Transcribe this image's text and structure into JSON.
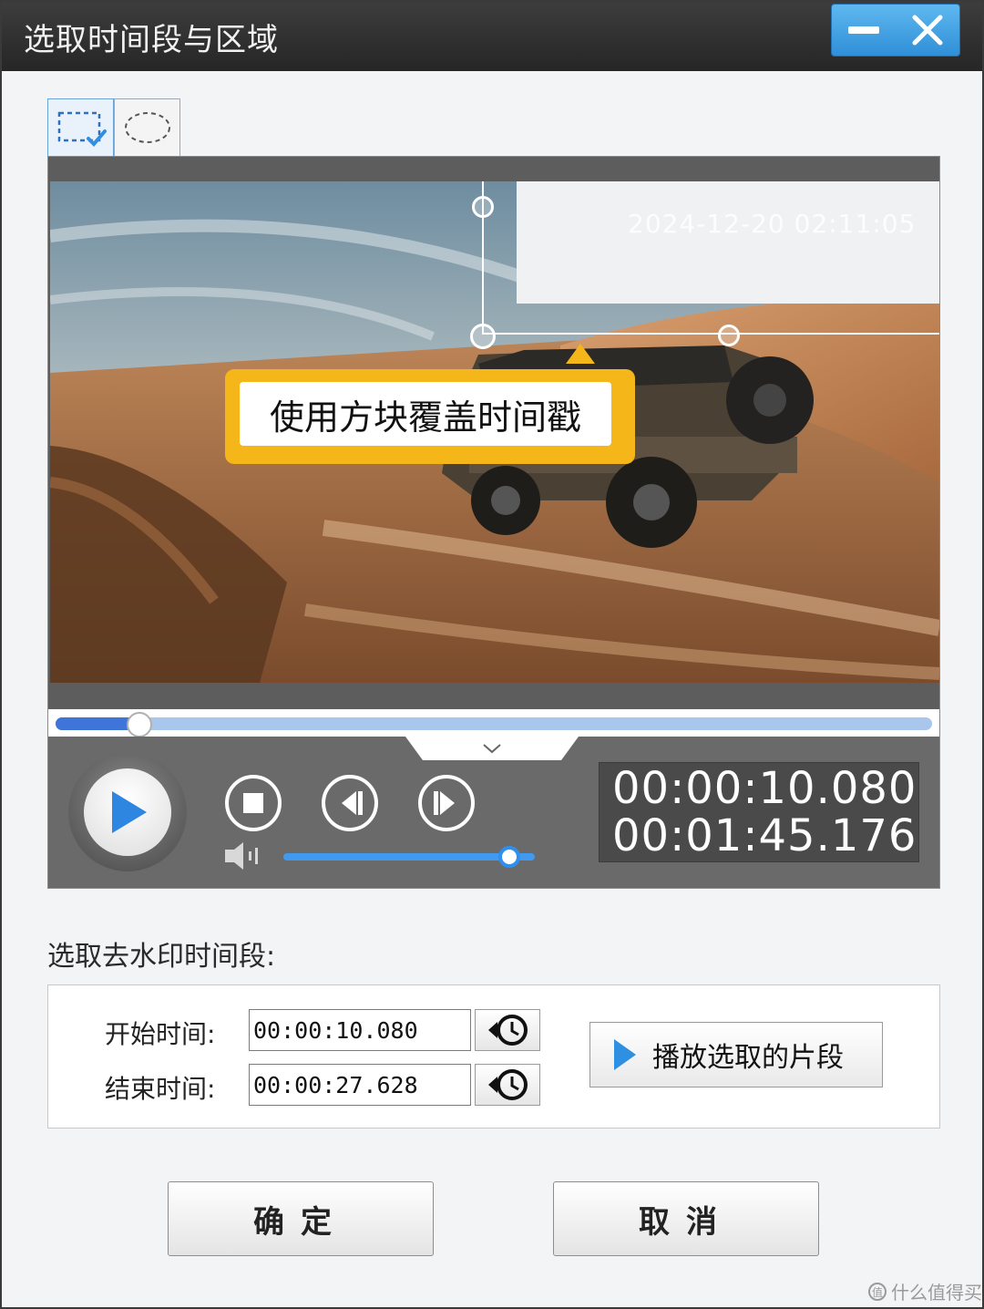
{
  "window": {
    "title": "选取时间段与区域",
    "minimize_icon": "minimize-icon",
    "close_icon": "close-icon",
    "accent_color": "#2f8fd8"
  },
  "shape_tools": {
    "items": [
      {
        "name": "rectangle-select",
        "icon": "rectangle-select-icon",
        "selected": true
      },
      {
        "name": "ellipse-select",
        "icon": "ellipse-select-icon",
        "selected": false
      }
    ]
  },
  "video": {
    "timestamp_overlay": "2024-12-20  02:11:05",
    "tooltip": "使用方块覆盖时间戳",
    "tooltip_color": "#f5b619"
  },
  "playback": {
    "progress_fraction": 0.096,
    "volume_fraction": 0.9,
    "current_time": "00:00:10.080",
    "total_time": "00:01:45.176"
  },
  "range": {
    "section_label": "选取去水印时间段:",
    "start_label": "开始时间:",
    "start_value": "00:00:10.080",
    "end_label": "结束时间:",
    "end_value": "00:00:27.628",
    "play_selection_label": "播放选取的片段"
  },
  "dialog": {
    "ok_label": "确定",
    "cancel_label": "取消"
  },
  "watermark": "什么值得买"
}
